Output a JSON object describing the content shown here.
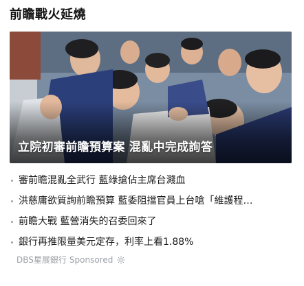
{
  "section": {
    "title": "前瞻戰火延燒"
  },
  "hero": {
    "caption": "立院初審前瞻預算案 混亂中完成詢答"
  },
  "news_items": [
    {
      "text": "審前瞻混亂全武行 藍綠搶佔主席台濺血"
    },
    {
      "text": "洪慈庸欲質詢前瞻預算 藍委阻擋官員上台嗆「維護程…"
    },
    {
      "text": "前瞻大戰 藍營消失的召委回來了"
    }
  ],
  "sponsored_item": {
    "text": "銀行再推限量美元定存，利率上看1.88%",
    "advertiser": "DBS星展銀行",
    "label": "Sponsored",
    "icon": "sun-icon"
  },
  "colors": {
    "bullet": "#9aa0a6",
    "sponsor_text": "#9aa0a6",
    "caption_text": "#ffffff"
  }
}
